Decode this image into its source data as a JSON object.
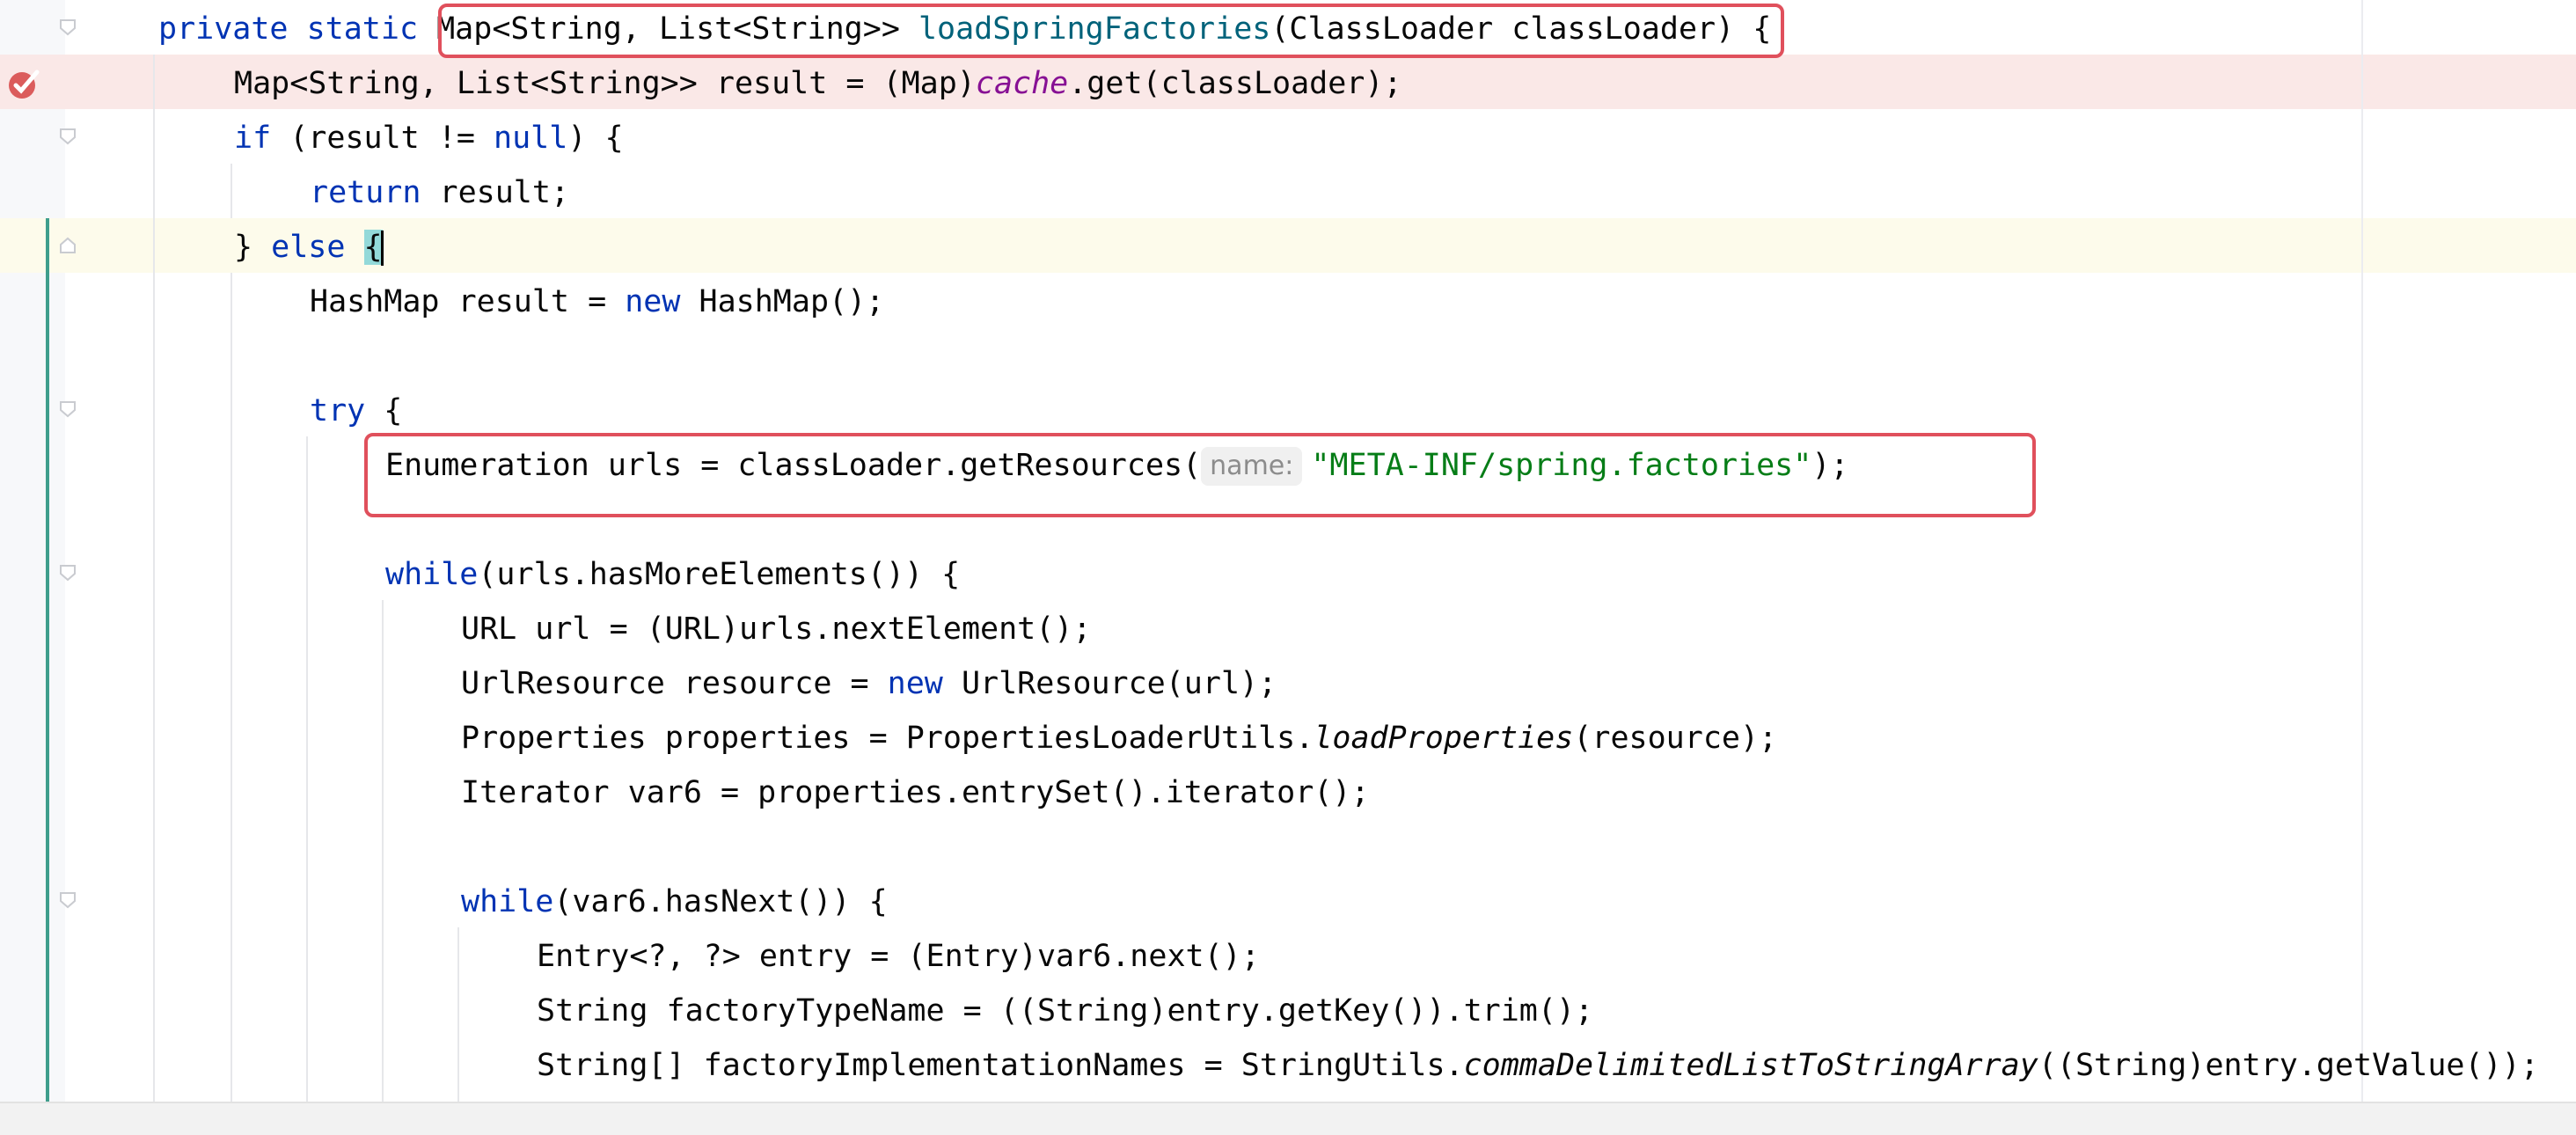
{
  "editor": {
    "lines": [
      {
        "segments": [
          {
            "t": "private",
            "c": "kw"
          },
          {
            "t": " "
          },
          {
            "t": "static",
            "c": "kw"
          },
          {
            "t": " Map<String, List<String>> "
          },
          {
            "t": "loadSpringFactories",
            "c": "fn"
          },
          {
            "t": "(ClassLoader classLoader) {"
          }
        ]
      },
      {
        "segments": [
          {
            "t": "Map<String, List<String>> result = (Map)"
          },
          {
            "t": "cache",
            "c": "fld"
          },
          {
            "t": ".get(classLoader);"
          }
        ]
      },
      {
        "segments": [
          {
            "t": "if",
            "c": "kw"
          },
          {
            "t": " (result != "
          },
          {
            "t": "null",
            "c": "kw"
          },
          {
            "t": ") {"
          }
        ]
      },
      {
        "segments": [
          {
            "t": "return",
            "c": "kw"
          },
          {
            "t": " result;"
          }
        ]
      },
      {
        "segments": [
          {
            "t": "} "
          },
          {
            "t": "else",
            "c": "kw"
          },
          {
            "t": " "
          },
          {
            "t": "{",
            "c": "brace"
          }
        ]
      },
      {
        "segments": [
          {
            "t": "HashMap result = "
          },
          {
            "t": "new",
            "c": "kw"
          },
          {
            "t": " HashMap();"
          }
        ]
      },
      {
        "segments": []
      },
      {
        "segments": [
          {
            "t": "try",
            "c": "kw"
          },
          {
            "t": " {"
          }
        ]
      },
      {
        "segments": [
          {
            "t": "Enumeration urls = classLoader.getResources("
          },
          {
            "t": "name:",
            "c": "hint"
          },
          {
            "t": "\"META-INF/spring.factories\"",
            "c": "str"
          },
          {
            "t": ");"
          }
        ]
      },
      {
        "segments": []
      },
      {
        "segments": [
          {
            "t": "while",
            "c": "kw"
          },
          {
            "t": "(urls.hasMoreElements()) {"
          }
        ]
      },
      {
        "segments": [
          {
            "t": "URL url = (URL)urls.nextElement();"
          }
        ]
      },
      {
        "segments": [
          {
            "t": "UrlResource resource = "
          },
          {
            "t": "new",
            "c": "kw"
          },
          {
            "t": " UrlResource(url);"
          }
        ]
      },
      {
        "segments": [
          {
            "t": "Properties properties = PropertiesLoaderUtils."
          },
          {
            "t": "loadProperties",
            "c": "it"
          },
          {
            "t": "(resource);"
          }
        ]
      },
      {
        "segments": [
          {
            "t": "Iterator var6 = properties.entrySet().iterator();"
          }
        ]
      },
      {
        "segments": []
      },
      {
        "segments": [
          {
            "t": "while",
            "c": "kw"
          },
          {
            "t": "(var6.hasNext()) {"
          }
        ]
      },
      {
        "segments": [
          {
            "t": "Entry<?, ?> entry = (Entry)var6.next();"
          }
        ]
      },
      {
        "segments": [
          {
            "t": "String factoryTypeName = ((String)entry.getKey()).trim();"
          }
        ]
      },
      {
        "segments": [
          {
            "t": "String[] factoryImplementationNames = StringUtils."
          },
          {
            "t": "commaDelimitedListToStringArray",
            "c": "it"
          },
          {
            "t": "((String)entry.getValue());"
          }
        ]
      }
    ]
  },
  "colors": {
    "keyword": "#0033b3",
    "method_declaration": "#00627a",
    "static_field": "#871094",
    "string": "#067d17",
    "breakpoint_line": "#fae8e7",
    "caret_line": "#fdfbeb",
    "annotation_box": "#e0505c"
  }
}
